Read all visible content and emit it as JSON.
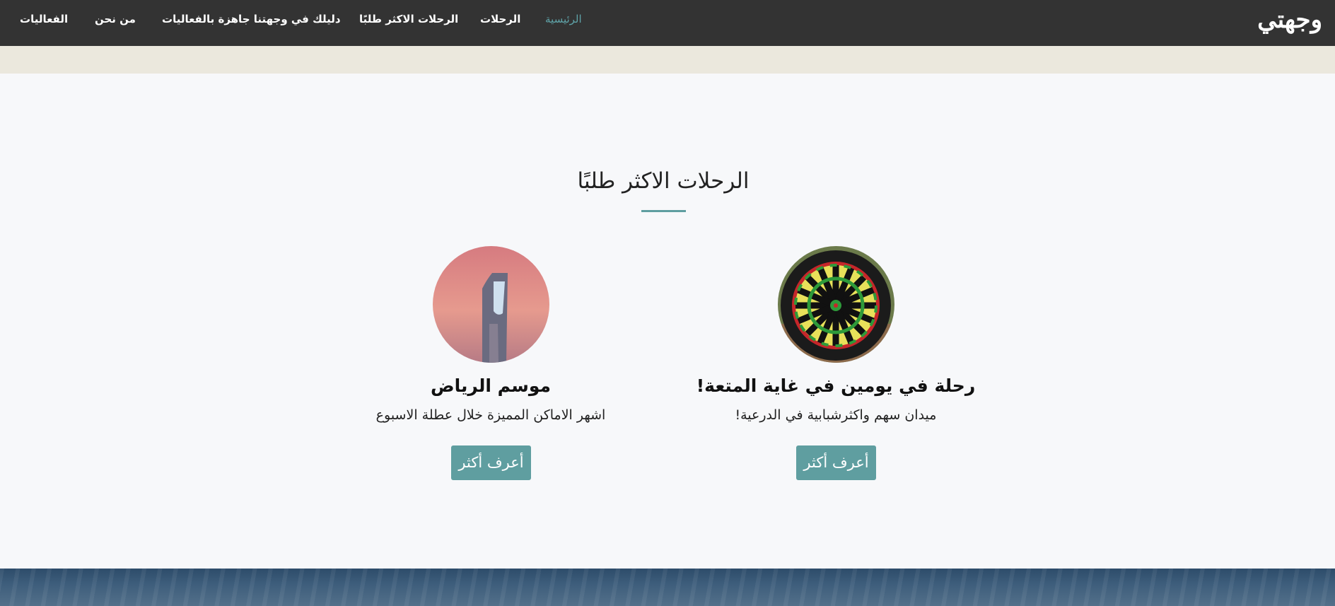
{
  "navbar": {
    "brand": "وجهتي",
    "items": [
      {
        "label": "الرئيسية",
        "active": true
      },
      {
        "label": "الرحلات"
      },
      {
        "label": "الرحلات الاكثر طلبًا"
      },
      {
        "label": "دليلك في وجهتنا جاهزة بالفعاليات"
      },
      {
        "label": "من نحن"
      },
      {
        "label": "الفعاليات"
      }
    ]
  },
  "section": {
    "title": "الرحلات الاكثر طلبًا"
  },
  "cards": [
    {
      "title": "رحلة في يومين في غاية المتعة!",
      "description": "ميدان سهم واكثرشبابية في الدرعية!",
      "button": "أعرف أكثر",
      "image_icon": "dartboard-image"
    },
    {
      "title": "موسم الرياض",
      "description": "اشهر الاماكن المميزة خلال عطلة الاسبوع",
      "button": "أعرف أكثر",
      "image_icon": "kingdom-tower-image"
    }
  ],
  "colors": {
    "navbar_bg": "#333333",
    "active_link": "#5fa3a8",
    "accent": "#5f9ea0",
    "strip": "#ebe8dd",
    "page_bg": "#f7f8fa"
  }
}
